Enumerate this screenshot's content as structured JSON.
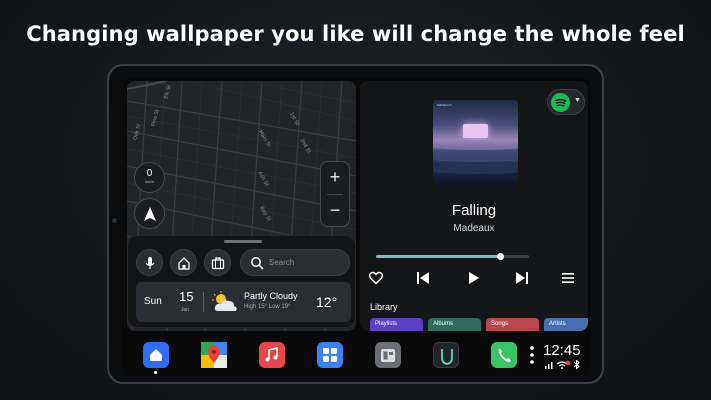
{
  "headline": "Changing wallpaper you like will change the whole feel",
  "map": {
    "speed_value": "0",
    "speed_unit": "km/h",
    "zoom_in": "+",
    "zoom_out": "−",
    "street_labels": [
      "Elk St",
      "Pine St",
      "Oak St",
      "Main St",
      "1st St",
      "2nd St",
      "Ash St",
      "Bay St"
    ]
  },
  "widget": {
    "search_placeholder": "Search",
    "weather": {
      "day": "Sun",
      "date": "15",
      "month": "Jan",
      "condition": "Partly Cloudy",
      "high_low": "High 15°  Low 19°",
      "temp": "12°"
    }
  },
  "media": {
    "source_app": "spotify-icon",
    "album_text": "MADEAUX",
    "track": "Falling",
    "artist": "Madeaux",
    "progress_fraction": 0.81,
    "library_title": "Library",
    "library_chips": [
      {
        "label": "Playlists",
        "color": "#5b3fc4"
      },
      {
        "label": "Albums",
        "color": "#2e6b5c"
      },
      {
        "label": "Songs",
        "color": "#b8464c"
      },
      {
        "label": "Artists",
        "color": "#4a6fb0"
      }
    ]
  },
  "dock": {
    "apps": [
      "home-app-icon",
      "maps-app-icon",
      "music-app-icon",
      "apps-grid-icon",
      "car-settings-icon",
      "shield-app-icon",
      "phone-app-icon"
    ],
    "time": "12:45"
  },
  "colors": {
    "accent": "#79c2c6",
    "spotify": "#1db954",
    "home_blue": "#2f6df6",
    "phone_green": "#39c463",
    "music_red": "#e5474b",
    "grid_blue": "#3b82f6"
  }
}
